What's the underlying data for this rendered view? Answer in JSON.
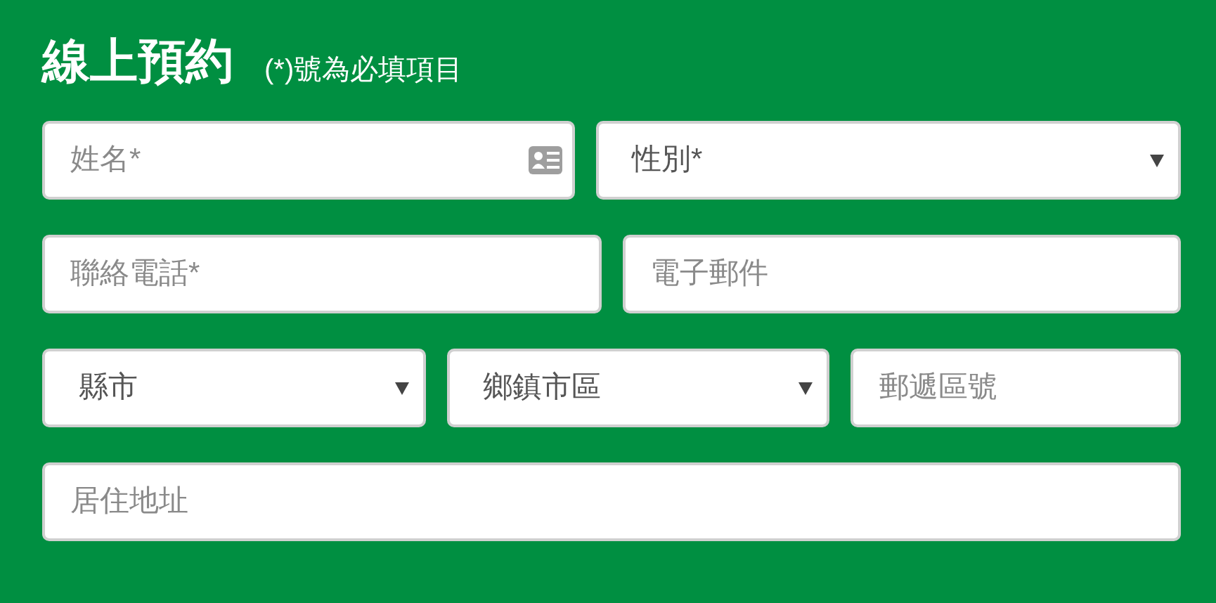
{
  "title": "線上預約",
  "note": "(*)號為必填項目",
  "rows": [
    [
      {
        "kind": "text_icon",
        "placeholder": "姓名*"
      },
      {
        "kind": "select",
        "placeholder": "性別*"
      }
    ],
    [
      {
        "kind": "text",
        "placeholder": "聯絡電話*"
      },
      {
        "kind": "text",
        "placeholder": "電子郵件"
      }
    ],
    [
      {
        "kind": "select",
        "placeholder": "縣市"
      },
      {
        "kind": "select",
        "placeholder": "鄉鎮市區"
      },
      {
        "kind": "text",
        "placeholder": "郵遞區號"
      }
    ],
    [
      {
        "kind": "text",
        "placeholder": "居住地址"
      }
    ]
  ]
}
